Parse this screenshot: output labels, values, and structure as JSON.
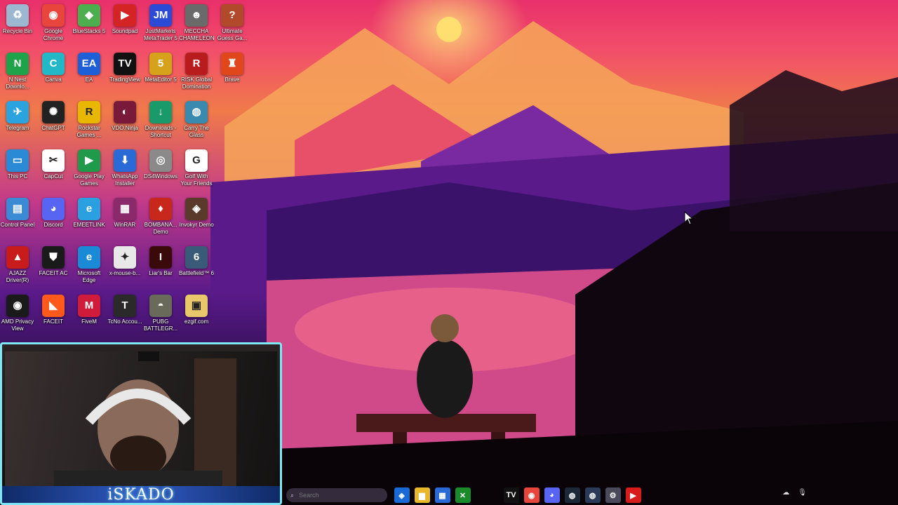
{
  "desktop_icons": [
    {
      "label": "Recycle Bin",
      "icon": "recycle-bin-icon",
      "color": "#9bb8d0",
      "glyph": "♻",
      "name": "recycle-bin"
    },
    {
      "label": "Google Chrome",
      "icon": "chrome-icon",
      "color": "#e8453c",
      "glyph": "◉",
      "name": "google-chrome"
    },
    {
      "label": "BlueStacks 5",
      "icon": "bluestacks-icon",
      "color": "#4cae4c",
      "glyph": "◆",
      "name": "bluestacks"
    },
    {
      "label": "Soundpad",
      "icon": "soundpad-icon",
      "color": "#d42424",
      "glyph": "▶",
      "name": "soundpad"
    },
    {
      "label": "JustMarkets MetaTrader 5",
      "icon": "justmarkets-icon",
      "color": "#2b4bd6",
      "glyph": "JM",
      "name": "justmarkets"
    },
    {
      "label": "MECCHA CHAMELEON",
      "icon": "meccha-icon",
      "color": "#6a6a6a",
      "glyph": "☻",
      "name": "meccha-chameleon"
    },
    {
      "label": "Ultimate Guess Ga...",
      "icon": "ultimate-guess-icon",
      "color": "#b04a2a",
      "glyph": "?",
      "name": "ultimate-guess"
    },
    {
      "label": "N Nest Downlo...",
      "icon": "nest-icon",
      "color": "#1fa34a",
      "glyph": "N",
      "name": "nest"
    },
    {
      "label": "Canva",
      "icon": "canva-icon",
      "color": "#22b8c8",
      "glyph": "C",
      "name": "canva"
    },
    {
      "label": "EA",
      "icon": "ea-icon",
      "color": "#1c5fd6",
      "glyph": "EA",
      "name": "ea"
    },
    {
      "label": "TradingView",
      "icon": "tradingview-icon",
      "color": "#111111",
      "glyph": "TV",
      "name": "tradingview"
    },
    {
      "label": "MetaEditor 5",
      "icon": "metaeditor-icon",
      "color": "#d6a21c",
      "glyph": "5",
      "name": "metaeditor"
    },
    {
      "label": "RISK Global Domination",
      "icon": "risk-icon",
      "color": "#b81c1c",
      "glyph": "R",
      "name": "risk"
    },
    {
      "label": "Brave",
      "icon": "brave-icon",
      "color": "#e0481c",
      "glyph": "♜",
      "name": "brave"
    },
    {
      "label": "Telegram",
      "icon": "telegram-icon",
      "color": "#2aa3de",
      "glyph": "✈",
      "name": "telegram"
    },
    {
      "label": "ChatGPT",
      "icon": "chatgpt-icon",
      "color": "#222222",
      "glyph": "✺",
      "name": "chatgpt"
    },
    {
      "label": "Rockstar Games ...",
      "icon": "rockstar-icon",
      "color": "#e8b800",
      "glyph": "R",
      "name": "rockstar"
    },
    {
      "label": "VDO.Ninja",
      "icon": "vdoninja-icon",
      "color": "#7a1a3a",
      "glyph": "◐",
      "name": "vdo-ninja"
    },
    {
      "label": "Downloads - Shortcut",
      "icon": "downloads-icon",
      "color": "#1a9a6a",
      "glyph": "↓",
      "name": "downloads"
    },
    {
      "label": "Carry The Glass",
      "icon": "carry-glass-icon",
      "color": "#3a8ab0",
      "glyph": "◍",
      "name": "carry-the-glass"
    },
    {
      "label": "This PC",
      "icon": "this-pc-icon",
      "color": "#2a8ad6",
      "glyph": "▭",
      "name": "this-pc"
    },
    {
      "label": "CapCut",
      "icon": "capcut-icon",
      "color": "#ffffff",
      "glyph": "✂",
      "name": "capcut"
    },
    {
      "label": "Google Play Games",
      "icon": "play-games-icon",
      "color": "#1e9a4a",
      "glyph": "▶",
      "name": "google-play-games"
    },
    {
      "label": "WhatsApp Installer",
      "icon": "whatsapp-installer-icon",
      "color": "#2a6ad6",
      "glyph": "⬇",
      "name": "whatsapp-installer"
    },
    {
      "label": "DS4Windows",
      "icon": "ds4windows-icon",
      "color": "#8a8a8a",
      "glyph": "◎",
      "name": "ds4windows"
    },
    {
      "label": "Golf With Your Friends",
      "icon": "golf-icon",
      "color": "#ffffff",
      "glyph": "G",
      "name": "golf-with-friends"
    },
    {
      "label": "Control Panel",
      "icon": "control-panel-icon",
      "color": "#3a8ad6",
      "glyph": "▤",
      "name": "control-panel"
    },
    {
      "label": "Discord",
      "icon": "discord-icon",
      "color": "#5865f2",
      "glyph": "◕",
      "name": "discord"
    },
    {
      "label": "EMEETLINK",
      "icon": "emeetlink-icon",
      "color": "#2aa0e0",
      "glyph": "e",
      "name": "emeetlink"
    },
    {
      "label": "WinRAR",
      "icon": "winrar-icon",
      "color": "#8a2a6a",
      "glyph": "▦",
      "name": "winrar"
    },
    {
      "label": "BOMBANA... Demo",
      "icon": "bombana-icon",
      "color": "#c8281c",
      "glyph": "♦",
      "name": "bombana"
    },
    {
      "label": "Invokyr Demo",
      "icon": "invokyr-icon",
      "color": "#5a3a2a",
      "glyph": "◈",
      "name": "invokyr"
    },
    {
      "label": "AJAZZ Driver(R)",
      "icon": "ajazz-icon",
      "color": "#c81c1c",
      "glyph": "▲",
      "name": "ajazz"
    },
    {
      "label": "FACEIT AC",
      "icon": "faceit-ac-icon",
      "color": "#1a1a1a",
      "glyph": "⛊",
      "name": "faceit-ac"
    },
    {
      "label": "Microsoft Edge",
      "icon": "edge-icon",
      "color": "#1a8ad6",
      "glyph": "e",
      "name": "microsoft-edge"
    },
    {
      "label": "x-mouse-b...",
      "icon": "xmouse-icon",
      "color": "#e8e8e8",
      "glyph": "✦",
      "name": "x-mouse"
    },
    {
      "label": "Liar's Bar",
      "icon": "liars-bar-icon",
      "color": "#3a0a0a",
      "glyph": "I",
      "name": "liars-bar"
    },
    {
      "label": "Battlefield™ 6",
      "icon": "battlefield-icon",
      "color": "#3a5a7a",
      "glyph": "6",
      "name": "battlefield"
    },
    {
      "label": "AMD Privacy View",
      "icon": "amd-icon",
      "color": "#1a1a1a",
      "glyph": "◉",
      "name": "amd-privacy-view"
    },
    {
      "label": "FACEIT",
      "icon": "faceit-icon",
      "color": "#ff5a1c",
      "glyph": "◣",
      "name": "faceit"
    },
    {
      "label": "FiveM",
      "icon": "fivem-icon",
      "color": "#d01c3a",
      "glyph": "M",
      "name": "fivem"
    },
    {
      "label": "TcNo Accou...",
      "icon": "tcno-icon",
      "color": "#2a2a2a",
      "glyph": "T",
      "name": "tcno"
    },
    {
      "label": "PUBG BATTLEGR...",
      "icon": "pubg-icon",
      "color": "#6a6a5a",
      "glyph": "◓",
      "name": "pubg"
    },
    {
      "label": "ezgif.com",
      "icon": "ezgif-icon",
      "color": "#e8c86a",
      "glyph": "▣",
      "name": "ezgif"
    }
  ],
  "webcam": {
    "streamer_name": "iSKADO"
  },
  "taskbar": {
    "search_placeholder": "Search",
    "apps": [
      {
        "name": "copilot",
        "icon": "copilot-icon",
        "color": "#1a6ad6",
        "glyph": "◈"
      },
      {
        "name": "file-explorer",
        "icon": "folder-icon",
        "color": "#e8b82a",
        "glyph": "▆"
      },
      {
        "name": "store",
        "icon": "store-icon",
        "color": "#2a6ad6",
        "glyph": "▦"
      },
      {
        "name": "xbox",
        "icon": "xbox-icon",
        "color": "#1a8a2a",
        "glyph": "✕"
      },
      {
        "name": "tradingview",
        "icon": "tradingview-icon",
        "color": "#111111",
        "glyph": "TV"
      },
      {
        "name": "chrome",
        "icon": "chrome-icon",
        "color": "#e8453c",
        "glyph": "◉"
      },
      {
        "name": "discord",
        "icon": "discord-icon",
        "color": "#5865f2",
        "glyph": "◕"
      },
      {
        "name": "steam",
        "icon": "steam-icon",
        "color": "#1b2838",
        "glyph": "◍"
      },
      {
        "name": "steam-alt",
        "icon": "steam-icon",
        "color": "#2a3a58",
        "glyph": "◍"
      },
      {
        "name": "settings",
        "icon": "gear-icon",
        "color": "#4a4a5a",
        "glyph": "⚙"
      },
      {
        "name": "youtube",
        "icon": "youtube-icon",
        "color": "#d81c1c",
        "glyph": "▶"
      }
    ]
  }
}
